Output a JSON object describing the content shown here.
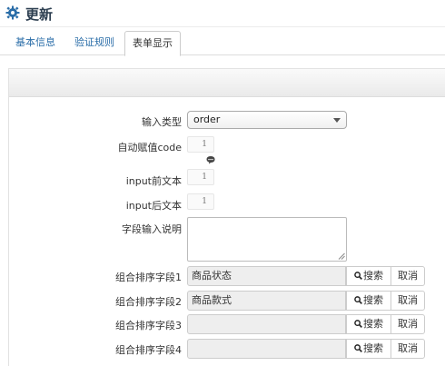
{
  "header": {
    "title": "更新",
    "icon": "gear-icon",
    "accent": "#2a6da8"
  },
  "tabs": [
    {
      "label": "基本信息"
    },
    {
      "label": "验证规则"
    },
    {
      "label": "表单显示",
      "active": true
    }
  ],
  "form": {
    "input_type": {
      "label": "输入类型",
      "value": "order"
    },
    "auto_value": {
      "label": "自动赋值code",
      "value": "1"
    },
    "before_text": {
      "label": "input前文本",
      "value": "1"
    },
    "after_text": {
      "label": "input后文本",
      "value": "1"
    },
    "description": {
      "label": "字段输入说明",
      "value": ""
    },
    "sort_fields": [
      {
        "label": "组合排序字段1",
        "value": "商品状态"
      },
      {
        "label": "组合排序字段2",
        "value": "商品款式"
      },
      {
        "label": "组合排序字段3",
        "value": ""
      },
      {
        "label": "组合排序字段4",
        "value": ""
      }
    ],
    "search_label": "搜索",
    "cancel_label": "取消"
  }
}
